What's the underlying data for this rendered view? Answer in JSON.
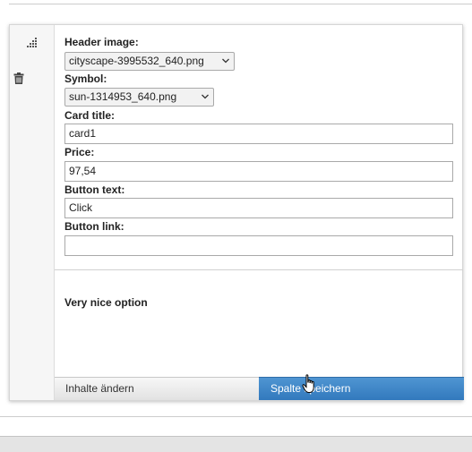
{
  "form": {
    "header_image": {
      "label": "Header image:",
      "selected": "cityscape-3995532_640.png"
    },
    "symbol": {
      "label": "Symbol:",
      "selected": "sun-1314953_640.png"
    },
    "card_title": {
      "label": "Card title:",
      "value": "card1"
    },
    "price": {
      "label": "Price:",
      "value": "97,54"
    },
    "button_text": {
      "label": "Button text:",
      "value": "Click"
    },
    "button_link": {
      "label": "Button link:",
      "value": ""
    }
  },
  "option_text": "Very nice option",
  "actions": {
    "change_label": "Inhalte ändern",
    "save_label": "Spalte speichern"
  },
  "icons": {
    "drag": "drag-handle-icon",
    "delete": "trash-icon",
    "dropdown": "chevron-down-icon",
    "cursor": "hand-pointer-cursor-icon"
  },
  "colors": {
    "primary_button": "#3b84c8",
    "secondary_button": "#ececec",
    "sidebar": "#f6f6f6"
  }
}
